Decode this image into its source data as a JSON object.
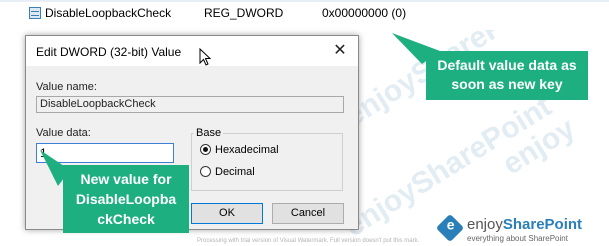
{
  "registry_row": {
    "name": "DisableLoopbackCheck",
    "type": "REG_DWORD",
    "data": "0x00000000 (0)"
  },
  "dialog": {
    "title": "Edit DWORD (32-bit) Value",
    "close_glyph": "✕",
    "value_name_label": "Value name:",
    "value_name": "DisableLoopbackCheck",
    "value_data_label": "Value data:",
    "value_data": "1",
    "base_label": "Base",
    "base_options": [
      {
        "label": "Hexadecimal",
        "checked": true
      },
      {
        "label": "Decimal",
        "checked": false
      }
    ],
    "ok_label": "OK",
    "cancel_label": "Cancel"
  },
  "callouts": {
    "default_value": "Default value data as soon as new key",
    "new_value_lines": [
      "New value for",
      "DisableLoopba",
      "ckCheck"
    ]
  },
  "watermark": {
    "brand_enjoy": "enjoy",
    "brand_sharepoint": "SharePoint",
    "tagline": "everything about SharePoint",
    "trial_note": "Processing with trial version of Visual Watermark. Full version doesn't put this mark."
  },
  "icons": {
    "registry_value": "reg-dword-icon",
    "mouse_cursor": "mouse-pointer-icon",
    "close": "close-icon"
  },
  "colors": {
    "callout": "#1eaf80",
    "focus_border": "#3c7fd6",
    "watermark_blue": "#2a7fb8"
  }
}
